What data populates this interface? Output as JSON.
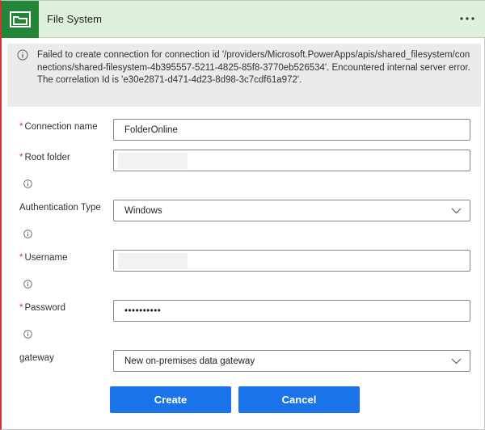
{
  "header": {
    "title": "File System",
    "icon": "folder-icon",
    "more_label": "···",
    "colors": {
      "icon_bg": "#238636",
      "header_bg": "#dff0dc"
    }
  },
  "error": {
    "message": "Failed to create connection for connection id '/providers/Microsoft.PowerApps/apis/shared_filesystem/connections/shared-filesystem-4b395557-5211-4825-85f8-3770eb526534'. Encountered internal server error. The correlation Id is 'e30e2871-d471-4d23-8d98-3c7cdf61a972'."
  },
  "form": {
    "connection_name": {
      "label": "Connection name",
      "required": "*",
      "value": "FolderOnline"
    },
    "root_folder": {
      "label": "Root folder",
      "required": "*",
      "value": ""
    },
    "auth_type": {
      "label": "Authentication Type",
      "value": "Windows"
    },
    "username": {
      "label": "Username",
      "required": "*",
      "value": ""
    },
    "password": {
      "label": "Password",
      "required": "*",
      "value": "••••••••••"
    },
    "gateway": {
      "label": "gateway",
      "value": "New on-premises data gateway"
    }
  },
  "buttons": {
    "create": "Create",
    "cancel": "Cancel"
  }
}
